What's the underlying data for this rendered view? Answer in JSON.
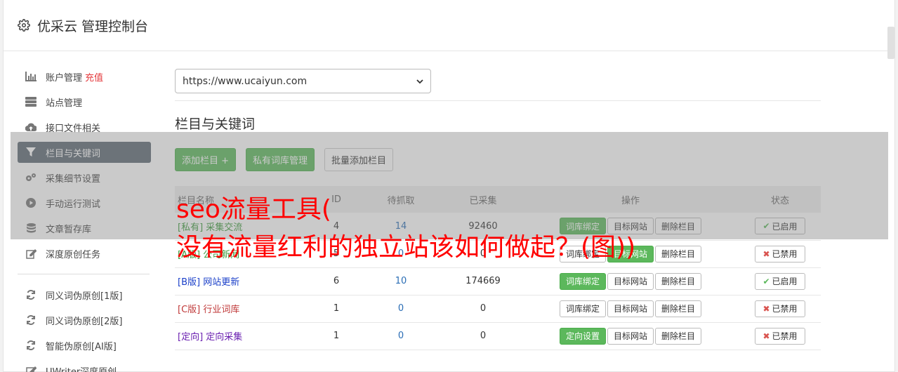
{
  "header": {
    "title": "优采云 管理控制台"
  },
  "sidebar": {
    "items": [
      {
        "label": "账户管理",
        "badge": "充值",
        "icon": "bar-chart-icon"
      },
      {
        "label": "站点管理",
        "icon": "server-icon"
      },
      {
        "label": "接口文件相关",
        "icon": "cloud-upload-icon"
      },
      {
        "label": "栏目与关键词",
        "icon": "filter-icon",
        "active": true
      },
      {
        "label": "采集细节设置",
        "icon": "gears-icon"
      },
      {
        "label": "手动运行测试",
        "icon": "play-circle-icon"
      },
      {
        "label": "文章暂存库",
        "icon": "database-icon"
      },
      {
        "label": "深度原创任务",
        "icon": "edit-icon"
      }
    ],
    "items2": [
      {
        "label": "同义词伪原创[1版]",
        "icon": "refresh-icon"
      },
      {
        "label": "同义词伪原创[2版]",
        "icon": "refresh-icon"
      },
      {
        "label": "智能伪原创[AI版]",
        "icon": "refresh-icon"
      },
      {
        "label": "UWriter深度原创",
        "icon": "edit-icon"
      }
    ]
  },
  "site_select": {
    "value": "https://www.ucaiyun.com"
  },
  "section": {
    "title": "栏目与关键词"
  },
  "toolbar": {
    "add": "添加栏目 +",
    "private_lib": "私有词库管理",
    "batch_add": "批量添加栏目"
  },
  "table": {
    "headers": [
      "栏目名称",
      "ID",
      "待抓取",
      "已采集",
      "操作",
      "状态"
    ],
    "rows": [
      {
        "name": "[私有] 采集交流",
        "name_color": "#3c9a3c",
        "id": "4",
        "wait": "14",
        "done": "92460",
        "op1": "词库绑定",
        "op1_green": true,
        "op2": "目标网站",
        "op3": "删除栏目",
        "status": "已启用",
        "status_ok": true
      },
      {
        "name": "[A版] 公司新闻",
        "name_color": "#3c9a3c",
        "id": "5",
        "wait": "0",
        "done": "0",
        "op1": "词库绑定",
        "op1_green": false,
        "op2": "目标网站",
        "op2_green": true,
        "op3": "删除栏目",
        "status": "已禁用",
        "status_ok": false
      },
      {
        "name": "[B版] 网站更新",
        "name_color": "#1a3fc9",
        "id": "6",
        "wait": "10",
        "done": "174669",
        "op1": "词库绑定",
        "op1_green": true,
        "op2": "目标网站",
        "op3": "删除栏目",
        "status": "已启用",
        "status_ok": true
      },
      {
        "name": "[C版] 行业词库",
        "name_color": "#c03a3a",
        "id": "1",
        "wait": "0",
        "done": "0",
        "op1": "词库绑定",
        "op1_green": false,
        "op2": "目标网站",
        "op3": "删除栏目",
        "status": "已禁用",
        "status_ok": false
      },
      {
        "name": "[定向] 定向采集",
        "name_color": "#6a1fb0",
        "id": "1",
        "wait": "0",
        "done": "0",
        "op1": "定向设置",
        "op1_green": true,
        "op2": "目标网站",
        "op3": "删除栏目",
        "status": "已禁用",
        "status_ok": false
      }
    ]
  },
  "overlay": {
    "line1": "seo流量工具(",
    "line2": "没有流量红利的独立站该如何做起？(图))"
  },
  "colors": {
    "accent_green": "#5cb85c",
    "active_nav": "#5e6a74",
    "link_blue": "#2a6db5",
    "overlay_text": "#ff0000"
  }
}
